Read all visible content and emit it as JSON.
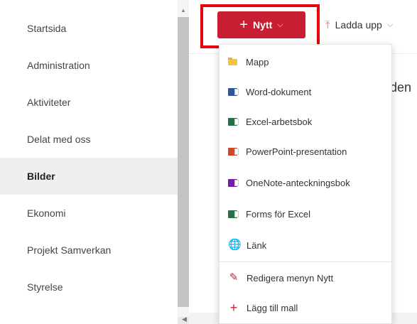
{
  "sidebar": {
    "items": [
      {
        "label": "Startsida"
      },
      {
        "label": "Administration"
      },
      {
        "label": "Aktiviteter"
      },
      {
        "label": "Delat med oss"
      },
      {
        "label": "Bilder"
      },
      {
        "label": "Ekonomi"
      },
      {
        "label": "Projekt Samverkan"
      },
      {
        "label": "Styrelse"
      }
    ],
    "selected": "Bilder"
  },
  "toolbar": {
    "new_label": "Nytt",
    "upload_label": "Ladda upp"
  },
  "background": {
    "title_fragment": "den"
  },
  "new_menu": {
    "items": [
      {
        "label": "Mapp",
        "icon": "folder-icon"
      },
      {
        "label": "Word-dokument",
        "icon": "word-icon"
      },
      {
        "label": "Excel-arbetsbok",
        "icon": "excel-icon"
      },
      {
        "label": "PowerPoint-presentation",
        "icon": "powerpoint-icon"
      },
      {
        "label": "OneNote-anteckningsbok",
        "icon": "onenote-icon"
      },
      {
        "label": "Forms för Excel",
        "icon": "forms-icon"
      },
      {
        "label": "Länk",
        "icon": "link-icon"
      },
      {
        "label": "Redigera menyn Nytt",
        "icon": "pencil-icon"
      },
      {
        "label": "Lägg till mall",
        "icon": "plus-icon"
      }
    ]
  },
  "colors": {
    "accent": "#c71e33",
    "highlight": "#e8000d",
    "word": "#2b579a",
    "excel": "#217346",
    "powerpoint": "#d24726",
    "onenote": "#7719aa",
    "forms": "#217346",
    "link": "#c71e33",
    "folder": "#f2c443"
  }
}
